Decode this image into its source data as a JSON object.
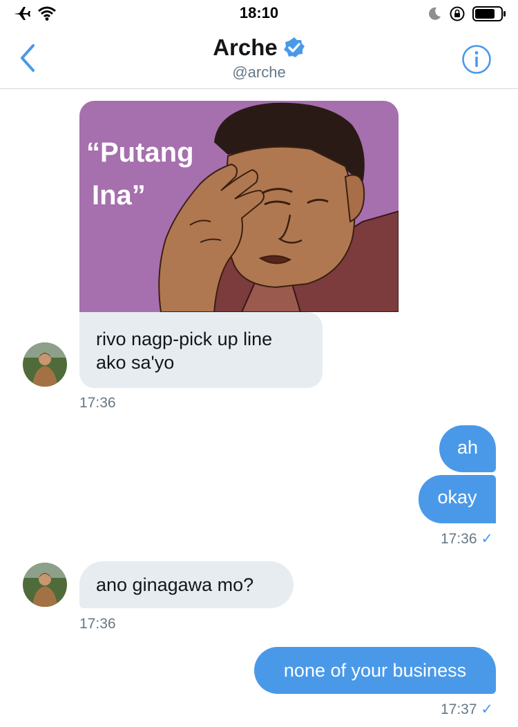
{
  "status_bar": {
    "time": "18:10"
  },
  "header": {
    "name": "Arche",
    "handle": "@arche"
  },
  "image_message": {
    "caption_line1": "“Putang",
    "caption_line2": "Ina”"
  },
  "messages": [
    {
      "dir": "in",
      "text_line1": "rivo nagp-pick up line",
      "text_line2": "ako sa'yo",
      "time": "17:36"
    },
    {
      "dir": "out",
      "text": "ah"
    },
    {
      "dir": "out",
      "text": "okay",
      "time": "17:36"
    },
    {
      "dir": "in",
      "text": "ano ginagawa mo?",
      "time": "17:36"
    },
    {
      "dir": "out",
      "text": "none of your business",
      "time": "17:37"
    }
  ],
  "colors": {
    "accent": "#4a99e9",
    "incoming_bubble": "#e6ecf0",
    "timestamp": "#657786",
    "image_bg": "#a66fad"
  },
  "icons": [
    "airplane-icon",
    "wifi-icon",
    "moon-icon",
    "rotation-lock-icon",
    "battery-icon",
    "back-chevron-icon",
    "verified-badge-icon",
    "info-icon",
    "checkmark-icon"
  ]
}
